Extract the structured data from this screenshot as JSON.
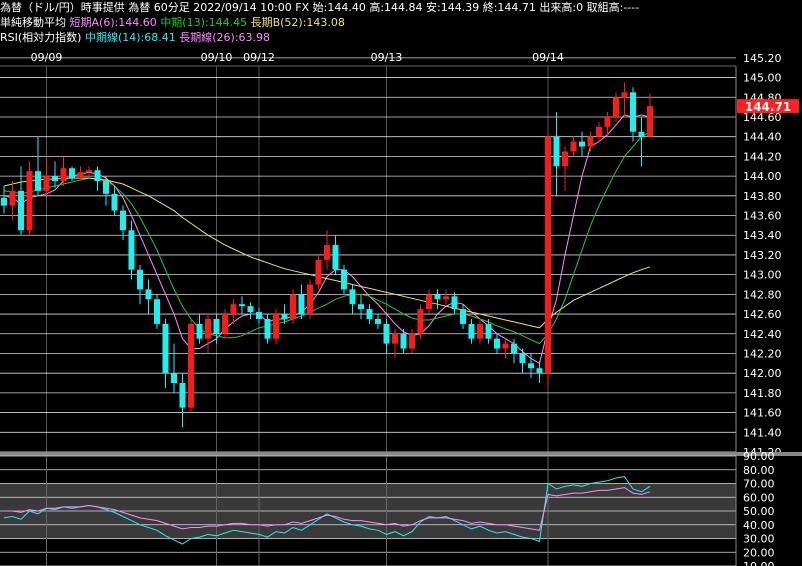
{
  "header": {
    "line1": "為替（ドル/円）時事提供 為替 60分足 2022/09/14 10:00 FX 始:144.40 高:144.84 安:144.39 終:144.71 出来高:0 取組高:----",
    "ma_title": "単純移動平均",
    "ma_short_label": "短期A(6):144.60",
    "ma_mid_label": "中期(13):144.45",
    "ma_long_label": "長期B(52):143.08",
    "rsi_title": "RSI(相対力指数)",
    "rsi_mid_label": "中期線(14):68.41",
    "rsi_long_label": "長期線(26):63.98"
  },
  "colors": {
    "up": "#ff1a1a",
    "down": "#1ef0f0",
    "ma_short": "#ff88ff",
    "ma_mid": "#22cc22",
    "ma_long": "#e8e85a",
    "rsi_mid": "#1ef0f0",
    "rsi_long": "#ff88ff",
    "grid": "#ffffff",
    "current_price_bg": "#ff2020"
  },
  "current_price": "144.71",
  "chart_data": [
    {
      "type": "candlestick",
      "title": "為替（ドル/円）時事提供 為替 60分足",
      "x_tick_labels": [
        "09/09",
        "09/10",
        "09/12",
        "09/13",
        "09/14"
      ],
      "x_tick_index": [
        5,
        25,
        30,
        45,
        64
      ],
      "ylim": [
        141.2,
        145.3
      ],
      "y_tick_labels": [
        "145.20",
        "145.00",
        "144.80",
        "144.60",
        "144.40",
        "144.20",
        "144.00",
        "143.80",
        "143.60",
        "143.40",
        "143.20",
        "143.00",
        "142.80",
        "142.60",
        "142.40",
        "142.20",
        "142.00",
        "141.80",
        "141.60",
        "141.40",
        "141.20"
      ],
      "candles": [
        {
          "o": 143.78,
          "h": 143.9,
          "l": 143.62,
          "c": 143.7
        },
        {
          "o": 143.7,
          "h": 143.95,
          "l": 143.55,
          "c": 143.85
        },
        {
          "o": 143.85,
          "h": 144.1,
          "l": 143.4,
          "c": 143.45
        },
        {
          "o": 143.45,
          "h": 144.15,
          "l": 143.4,
          "c": 144.05
        },
        {
          "o": 144.05,
          "h": 144.4,
          "l": 143.8,
          "c": 143.85
        },
        {
          "o": 143.85,
          "h": 144.2,
          "l": 143.8,
          "c": 144.0
        },
        {
          "o": 144.0,
          "h": 144.15,
          "l": 143.88,
          "c": 143.95
        },
        {
          "o": 143.95,
          "h": 144.2,
          "l": 143.9,
          "c": 144.08
        },
        {
          "o": 144.08,
          "h": 144.1,
          "l": 143.95,
          "c": 143.98
        },
        {
          "o": 143.98,
          "h": 144.1,
          "l": 143.96,
          "c": 144.04
        },
        {
          "o": 144.04,
          "h": 144.1,
          "l": 143.98,
          "c": 144.06
        },
        {
          "o": 144.06,
          "h": 144.1,
          "l": 143.85,
          "c": 143.95
        },
        {
          "o": 143.95,
          "h": 144.0,
          "l": 143.7,
          "c": 143.82
        },
        {
          "o": 143.82,
          "h": 143.9,
          "l": 143.6,
          "c": 143.65
        },
        {
          "o": 143.65,
          "h": 143.7,
          "l": 143.35,
          "c": 143.45
        },
        {
          "o": 143.45,
          "h": 143.55,
          "l": 142.95,
          "c": 143.05
        },
        {
          "o": 143.05,
          "h": 143.1,
          "l": 142.7,
          "c": 142.85
        },
        {
          "o": 142.85,
          "h": 142.95,
          "l": 142.6,
          "c": 142.75
        },
        {
          "o": 142.75,
          "h": 142.8,
          "l": 142.45,
          "c": 142.5
        },
        {
          "o": 142.5,
          "h": 142.55,
          "l": 141.85,
          "c": 142.0
        },
        {
          "o": 142.0,
          "h": 142.3,
          "l": 141.8,
          "c": 141.9
        },
        {
          "o": 141.9,
          "h": 142.0,
          "l": 141.45,
          "c": 141.65
        },
        {
          "o": 141.65,
          "h": 142.55,
          "l": 141.6,
          "c": 142.5
        },
        {
          "o": 142.5,
          "h": 142.6,
          "l": 142.3,
          "c": 142.35
        },
        {
          "o": 142.35,
          "h": 142.6,
          "l": 142.2,
          "c": 142.55
        },
        {
          "o": 142.55,
          "h": 142.6,
          "l": 142.3,
          "c": 142.4
        },
        {
          "o": 142.4,
          "h": 142.65,
          "l": 142.35,
          "c": 142.6
        },
        {
          "o": 142.6,
          "h": 142.75,
          "l": 142.5,
          "c": 142.7
        },
        {
          "o": 142.7,
          "h": 142.78,
          "l": 142.6,
          "c": 142.68
        },
        {
          "o": 142.68,
          "h": 142.72,
          "l": 142.55,
          "c": 142.62
        },
        {
          "o": 142.62,
          "h": 142.66,
          "l": 142.5,
          "c": 142.55
        },
        {
          "o": 142.55,
          "h": 142.6,
          "l": 142.3,
          "c": 142.35
        },
        {
          "o": 142.35,
          "h": 142.65,
          "l": 142.3,
          "c": 142.6
        },
        {
          "o": 142.6,
          "h": 142.7,
          "l": 142.5,
          "c": 142.55
        },
        {
          "o": 142.55,
          "h": 142.85,
          "l": 142.5,
          "c": 142.8
        },
        {
          "o": 142.8,
          "h": 142.9,
          "l": 142.55,
          "c": 142.6
        },
        {
          "o": 142.6,
          "h": 142.95,
          "l": 142.55,
          "c": 142.9
        },
        {
          "o": 142.9,
          "h": 143.2,
          "l": 142.85,
          "c": 143.15
        },
        {
          "o": 143.15,
          "h": 143.45,
          "l": 143.05,
          "c": 143.3
        },
        {
          "o": 143.3,
          "h": 143.4,
          "l": 143.0,
          "c": 143.05
        },
        {
          "o": 143.05,
          "h": 143.1,
          "l": 142.8,
          "c": 142.85
        },
        {
          "o": 142.85,
          "h": 142.9,
          "l": 142.6,
          "c": 142.7
        },
        {
          "o": 142.7,
          "h": 142.8,
          "l": 142.55,
          "c": 142.65
        },
        {
          "o": 142.65,
          "h": 142.7,
          "l": 142.5,
          "c": 142.55
        },
        {
          "o": 142.55,
          "h": 142.6,
          "l": 142.45,
          "c": 142.5
        },
        {
          "o": 142.5,
          "h": 142.55,
          "l": 142.2,
          "c": 142.3
        },
        {
          "o": 142.3,
          "h": 142.45,
          "l": 142.15,
          "c": 142.4
        },
        {
          "o": 142.4,
          "h": 142.45,
          "l": 142.2,
          "c": 142.25
        },
        {
          "o": 142.25,
          "h": 142.45,
          "l": 142.2,
          "c": 142.4
        },
        {
          "o": 142.4,
          "h": 142.7,
          "l": 142.35,
          "c": 142.65
        },
        {
          "o": 142.65,
          "h": 142.85,
          "l": 142.6,
          "c": 142.8
        },
        {
          "o": 142.8,
          "h": 142.85,
          "l": 142.65,
          "c": 142.75
        },
        {
          "o": 142.75,
          "h": 142.85,
          "l": 142.7,
          "c": 142.78
        },
        {
          "o": 142.78,
          "h": 142.82,
          "l": 142.6,
          "c": 142.65
        },
        {
          "o": 142.65,
          "h": 142.7,
          "l": 142.45,
          "c": 142.5
        },
        {
          "o": 142.5,
          "h": 142.55,
          "l": 142.3,
          "c": 142.35
        },
        {
          "o": 142.35,
          "h": 142.55,
          "l": 142.3,
          "c": 142.5
        },
        {
          "o": 142.5,
          "h": 142.55,
          "l": 142.3,
          "c": 142.35
        },
        {
          "o": 142.35,
          "h": 142.4,
          "l": 142.2,
          "c": 142.25
        },
        {
          "o": 142.25,
          "h": 142.35,
          "l": 142.15,
          "c": 142.3
        },
        {
          "o": 142.3,
          "h": 142.35,
          "l": 142.1,
          "c": 142.2
        },
        {
          "o": 142.2,
          "h": 142.25,
          "l": 142.0,
          "c": 142.1
        },
        {
          "o": 142.1,
          "h": 142.2,
          "l": 141.95,
          "c": 142.05
        },
        {
          "o": 142.05,
          "h": 142.12,
          "l": 141.9,
          "c": 142.0
        },
        {
          "o": 142.0,
          "h": 144.45,
          "l": 141.85,
          "c": 144.4
        },
        {
          "o": 144.4,
          "h": 144.65,
          "l": 143.8,
          "c": 144.1
        },
        {
          "o": 144.1,
          "h": 144.3,
          "l": 143.85,
          "c": 144.25
        },
        {
          "o": 144.25,
          "h": 144.4,
          "l": 144.2,
          "c": 144.35
        },
        {
          "o": 144.35,
          "h": 144.45,
          "l": 144.2,
          "c": 144.3
        },
        {
          "o": 144.3,
          "h": 144.45,
          "l": 144.25,
          "c": 144.4
        },
        {
          "o": 144.4,
          "h": 144.55,
          "l": 144.35,
          "c": 144.5
        },
        {
          "o": 144.5,
          "h": 144.65,
          "l": 144.4,
          "c": 144.6
        },
        {
          "o": 144.6,
          "h": 144.85,
          "l": 144.55,
          "c": 144.8
        },
        {
          "o": 144.8,
          "h": 144.95,
          "l": 144.6,
          "c": 144.85
        },
        {
          "o": 144.85,
          "h": 144.9,
          "l": 144.35,
          "c": 144.45
        },
        {
          "o": 144.45,
          "h": 144.6,
          "l": 144.1,
          "c": 144.4
        },
        {
          "o": 144.4,
          "h": 144.84,
          "l": 144.39,
          "c": 144.71
        }
      ],
      "series": [
        {
          "name": "短期A(6)",
          "color_key": "ma_short",
          "values": [
            143.8,
            143.78,
            143.72,
            143.78,
            143.8,
            143.82,
            143.86,
            143.95,
            144.0,
            144.02,
            144.04,
            144.02,
            143.98,
            143.9,
            143.78,
            143.6,
            143.4,
            143.2,
            143.0,
            142.8,
            142.6,
            142.35,
            142.25,
            142.25,
            142.3,
            142.35,
            142.45,
            142.52,
            142.58,
            142.6,
            142.6,
            142.52,
            142.55,
            142.55,
            142.58,
            142.62,
            142.7,
            142.82,
            142.98,
            143.05,
            143.05,
            142.98,
            142.88,
            142.78,
            142.7,
            142.6,
            142.5,
            142.42,
            142.38,
            142.4,
            142.48,
            142.6,
            142.68,
            142.72,
            142.7,
            142.62,
            142.55,
            142.48,
            142.4,
            142.35,
            142.3,
            142.22,
            142.15,
            142.1,
            142.45,
            142.75,
            143.2,
            143.6,
            144.0,
            144.3,
            144.35,
            144.42,
            144.52,
            144.62,
            144.6,
            144.62,
            144.6
          ]
        },
        {
          "name": "中期(13)",
          "color_key": "ma_mid",
          "values": [
            143.85,
            143.84,
            143.82,
            143.84,
            143.86,
            143.88,
            143.9,
            143.92,
            143.94,
            143.96,
            143.98,
            143.97,
            143.95,
            143.9,
            143.82,
            143.72,
            143.58,
            143.42,
            143.25,
            143.05,
            142.85,
            142.68,
            142.55,
            142.45,
            142.4,
            142.38,
            142.36,
            142.36,
            142.38,
            142.42,
            142.46,
            142.48,
            142.5,
            142.52,
            142.55,
            142.58,
            142.62,
            142.66,
            142.7,
            142.75,
            142.78,
            142.8,
            142.8,
            142.78,
            142.74,
            142.7,
            142.65,
            142.6,
            142.56,
            142.54,
            142.54,
            142.56,
            142.58,
            142.6,
            142.6,
            142.58,
            142.55,
            142.52,
            142.48,
            142.45,
            142.42,
            142.38,
            142.34,
            142.3,
            142.4,
            142.55,
            142.75,
            143.0,
            143.25,
            143.5,
            143.7,
            143.88,
            144.05,
            144.2,
            144.3,
            144.4,
            144.45
          ]
        },
        {
          "name": "長期B(52)",
          "color_key": "ma_long",
          "values": [
            143.9,
            143.92,
            143.94,
            143.95,
            143.96,
            143.97,
            143.97,
            143.98,
            143.98,
            143.98,
            143.98,
            143.97,
            143.96,
            143.94,
            143.92,
            143.88,
            143.84,
            143.8,
            143.75,
            143.7,
            143.65,
            143.58,
            143.52,
            143.46,
            143.4,
            143.35,
            143.3,
            143.26,
            143.22,
            143.18,
            143.15,
            143.12,
            143.09,
            143.06,
            143.04,
            143.02,
            143.0,
            142.98,
            142.96,
            142.94,
            142.92,
            142.9,
            142.88,
            142.86,
            142.84,
            142.82,
            142.8,
            142.78,
            142.76,
            142.74,
            142.72,
            142.7,
            142.68,
            142.66,
            142.64,
            142.62,
            142.6,
            142.58,
            142.56,
            142.54,
            142.52,
            142.5,
            142.48,
            142.46,
            142.55,
            142.62,
            142.68,
            142.74,
            142.78,
            142.82,
            142.86,
            142.9,
            142.94,
            142.98,
            143.02,
            143.05,
            143.08
          ]
        }
      ]
    },
    {
      "type": "line",
      "title": "RSI(相対力指数)",
      "ylim": [
        10,
        90
      ],
      "y_tick_labels": [
        "90.00",
        "80.00",
        "70.00",
        "60.00",
        "50.00",
        "40.00",
        "30.00",
        "20.00",
        "10.00"
      ],
      "shaded_band": [
        30,
        70
      ],
      "series": [
        {
          "name": "中期線(14)",
          "color_key": "rsi_mid",
          "values": [
            45,
            46,
            44,
            50,
            48,
            52,
            51,
            53,
            52,
            53,
            54,
            53,
            51,
            49,
            46,
            43,
            40,
            38,
            36,
            32,
            29,
            26,
            30,
            31,
            33,
            32,
            34,
            36,
            35,
            34,
            33,
            31,
            35,
            34,
            38,
            36,
            40,
            44,
            48,
            45,
            42,
            40,
            39,
            37,
            36,
            33,
            35,
            32,
            35,
            42,
            46,
            45,
            46,
            43,
            40,
            37,
            39,
            36,
            34,
            35,
            33,
            31,
            30,
            28,
            70,
            66,
            68,
            69,
            68,
            70,
            71,
            72,
            74,
            75,
            66,
            64,
            68
          ]
        },
        {
          "name": "長期線(26)",
          "color_key": "rsi_long",
          "values": [
            50,
            50,
            49,
            51,
            50,
            52,
            52,
            53,
            53,
            53,
            54,
            53,
            52,
            51,
            49,
            47,
            45,
            44,
            43,
            41,
            39,
            37,
            38,
            38,
            39,
            39,
            40,
            41,
            41,
            40,
            40,
            39,
            40,
            40,
            42,
            41,
            43,
            45,
            47,
            46,
            44,
            43,
            43,
            42,
            41,
            40,
            41,
            39,
            40,
            43,
            45,
            45,
            45,
            44,
            43,
            41,
            42,
            41,
            40,
            40,
            39,
            38,
            37,
            36,
            62,
            61,
            62,
            63,
            63,
            64,
            65,
            65,
            66,
            67,
            63,
            62,
            64
          ]
        }
      ]
    }
  ]
}
